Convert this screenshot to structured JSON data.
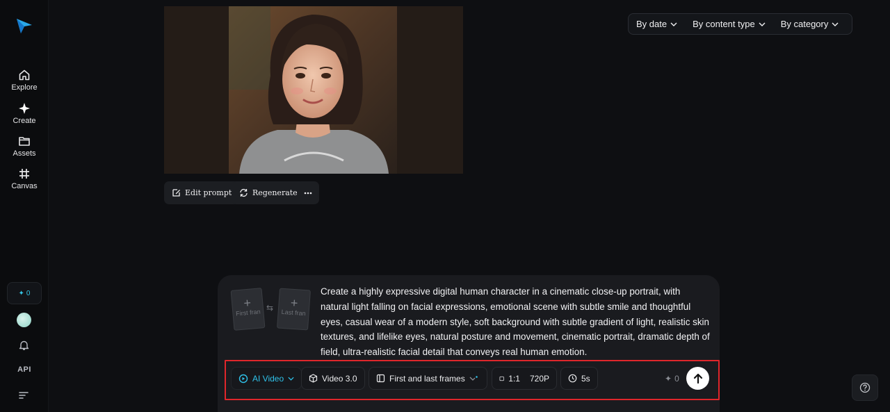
{
  "sidebar": {
    "items": [
      {
        "label": "Explore",
        "icon": "home-icon"
      },
      {
        "label": "Create",
        "icon": "sparkle-icon"
      },
      {
        "label": "Assets",
        "icon": "folder-icon"
      },
      {
        "label": "Canvas",
        "icon": "canvas-icon"
      }
    ],
    "credits": "0",
    "api_label": "API"
  },
  "filters": {
    "date": "By date",
    "content_type": "By content type",
    "category": "By category"
  },
  "actions": {
    "edit_prompt": "Edit prompt",
    "regenerate": "Regenerate"
  },
  "prompt": {
    "first_frame": "First fran",
    "last_frame": "Last fran",
    "text": "Create a highly expressive digital human character in a cinematic close-up portrait, with natural light falling on facial expressions, emotional scene with subtle smile and thoughtful eyes, casual wear of a modern style, soft background with subtle gradient of light, realistic skin textures, and lifelike eyes, natural posture and movement, cinematic portrait, dramatic depth of field, ultra-realistic facial detail that conveys real human emotion."
  },
  "toolbar": {
    "mode": "AI Video",
    "model": "Video 3.0",
    "frames_mode": "First and last frames",
    "ratio": "1:1",
    "resolution": "720P",
    "duration": "5s",
    "cost": "0"
  },
  "colors": {
    "accent": "#2fc2ea",
    "highlight_border": "#e0262b",
    "background": "#0e0f12"
  }
}
